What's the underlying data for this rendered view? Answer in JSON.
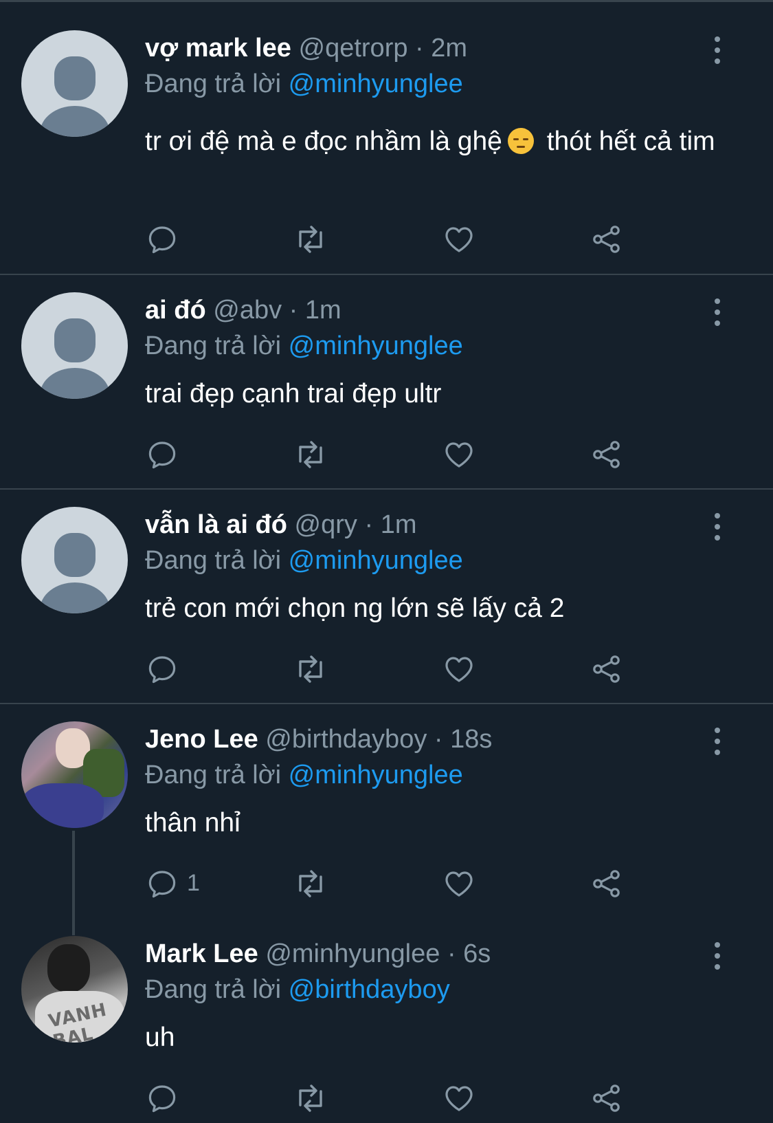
{
  "reply_prefix": "Đang trả lời",
  "emoji_name": "pensive-face",
  "colors": {
    "background": "#15202b",
    "divider": "#38444d",
    "secondary_text": "#8899a6",
    "mention": "#1d9bf0"
  },
  "tweets": [
    {
      "name": "vợ mark lee",
      "handle": "@qetrorp",
      "sep": "·",
      "time": "2m",
      "reply_to": "@minhyunglee",
      "text_before": "tr ơi đệ mà e đọc nhầm là ghệ",
      "text_after": "thót hết cả tim",
      "reply_count": ""
    },
    {
      "name": "ai đó",
      "handle": "@abv",
      "sep": "·",
      "time": "1m",
      "reply_to": "@minhyunglee",
      "text": "trai đẹp cạnh trai đẹp ultr",
      "reply_count": ""
    },
    {
      "name": "vẫn là ai đó",
      "handle": "@qry",
      "sep": "·",
      "time": "1m",
      "reply_to": "@minhyunglee",
      "text": "trẻ con mới chọn ng lớn sẽ lấy cả 2",
      "reply_count": ""
    },
    {
      "name": "Jeno Lee",
      "handle": "@birthdayboy",
      "sep": "·",
      "time": "18s",
      "reply_to": "@minhyunglee",
      "text": "thân nhỉ",
      "reply_count": "1"
    },
    {
      "name": "Mark Lee",
      "handle": "@minhyunglee",
      "sep": "·",
      "time": "6s",
      "reply_to": "@birthdayboy",
      "text": "uh",
      "reply_count": "",
      "avatar_print": "VANH BAL"
    }
  ]
}
